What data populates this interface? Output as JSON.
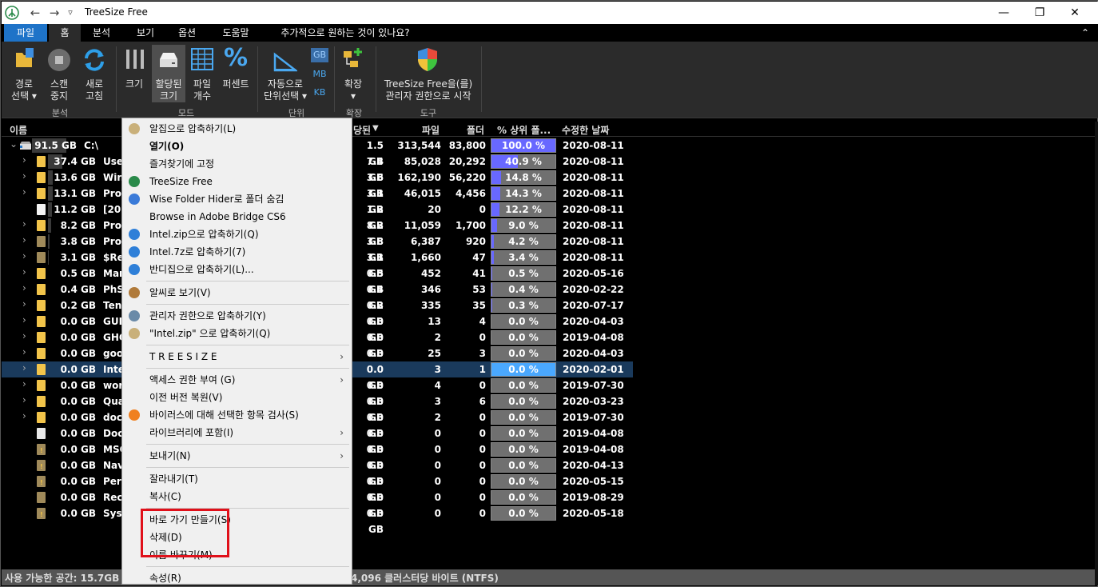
{
  "window": {
    "title": "TreeSize Free",
    "btn_min": "—",
    "btn_max": "❐",
    "btn_close": "✕"
  },
  "quickaccess": {
    "back": "←",
    "forward": "→",
    "dropdown": "▿"
  },
  "menu": {
    "file": "파일",
    "home": "홈",
    "analysis": "분석",
    "view": "보기",
    "options": "옵션",
    "help": "도움말",
    "search": "추가적으로 원하는 것이 있나요?",
    "collapse": "⌃"
  },
  "ribbon": {
    "path_select_1": "경로",
    "path_select_2": "선택 ▾",
    "scan_stop_1": "스캔",
    "scan_stop_2": "중지",
    "refresh_1": "새로",
    "refresh_2": "고침",
    "grp_analysis": "분석",
    "size": "크기",
    "alloc_size_1": "할당된",
    "alloc_size_2": "크기",
    "file_count_1": "파일",
    "file_count_2": "개수",
    "percent": "퍼센트",
    "grp_mode": "모드",
    "auto_unit_1": "자동으로",
    "auto_unit_2": "단위선택 ▾",
    "unit_gb": "GB",
    "unit_mb": "MB",
    "unit_kb": "KB",
    "grp_unit": "단위",
    "expand_1": "확장",
    "expand_2": "▾",
    "grp_expand": "확장",
    "admin_1": "TreeSize Free을(를)",
    "admin_2": "관리자 권한으로 시작",
    "grp_tools": "도구"
  },
  "columns": {
    "name": "이름",
    "alloc": "당된",
    "files": "파일",
    "folders": "폴더",
    "pct": "% 상위 폴...",
    "modified": "수정한 날짜"
  },
  "root": {
    "expand": "⌄",
    "size": "91.5 GB",
    "name": "C:\\",
    "alloc": "1.5 GB",
    "files": "313,544",
    "folders": "83,800",
    "pct": "100.0 %",
    "pct_value": 100,
    "date": "2020-08-11"
  },
  "rows": [
    {
      "expand": "›",
      "size": "37.4 GB",
      "name": "User",
      "alloc": "7.4 GB",
      "files": "85,028",
      "folders": "20,292",
      "pct": "40.9 %",
      "pct_value": 40.9,
      "date": "2020-08-11",
      "icon": "folder"
    },
    {
      "expand": "›",
      "size": "13.6 GB",
      "name": "Win",
      "alloc": "3.6 GB",
      "files": "162,190",
      "folders": "56,220",
      "pct": "14.8 %",
      "pct_value": 14.8,
      "date": "2020-08-11",
      "icon": "folder"
    },
    {
      "expand": "›",
      "size": "13.1 GB",
      "name": "Pro",
      "alloc": "3.1 GB",
      "files": "46,015",
      "folders": "4,456",
      "pct": "14.3 %",
      "pct_value": 14.3,
      "date": "2020-08-11",
      "icon": "folder"
    },
    {
      "expand": "",
      "size": "11.2 GB",
      "name": "[20",
      "alloc": "1.2 GB",
      "files": "20",
      "folders": "0",
      "pct": "12.2 %",
      "pct_value": 12.2,
      "date": "2020-08-11",
      "icon": "file"
    },
    {
      "expand": "›",
      "size": "8.2 GB",
      "name": "Pro",
      "alloc": "8.2 GB",
      "files": "11,059",
      "folders": "1,700",
      "pct": "9.0 %",
      "pct_value": 9.0,
      "date": "2020-08-11",
      "icon": "folder"
    },
    {
      "expand": "›",
      "size": "3.8 GB",
      "name": "Pro",
      "alloc": "3.8 GB",
      "files": "6,387",
      "folders": "920",
      "pct": "4.2 %",
      "pct_value": 4.2,
      "date": "2020-08-11",
      "icon": "folder-dim"
    },
    {
      "expand": "›",
      "size": "3.1 GB",
      "name": "$Re",
      "alloc": "3.1 GB",
      "files": "1,660",
      "folders": "47",
      "pct": "3.4 %",
      "pct_value": 3.4,
      "date": "2020-08-11",
      "icon": "folder-dim"
    },
    {
      "expand": "›",
      "size": "0.5 GB",
      "name": "Mar",
      "alloc": "0.5 GB",
      "files": "452",
      "folders": "41",
      "pct": "0.5 %",
      "pct_value": 0.5,
      "date": "2020-05-16",
      "icon": "folder"
    },
    {
      "expand": "›",
      "size": "0.4 GB",
      "name": "PhS",
      "alloc": "0.4 GB",
      "files": "346",
      "folders": "53",
      "pct": "0.4 %",
      "pct_value": 0.4,
      "date": "2020-02-22",
      "icon": "folder"
    },
    {
      "expand": "›",
      "size": "0.2 GB",
      "name": "Ten",
      "alloc": "0.2 GB",
      "files": "335",
      "folders": "35",
      "pct": "0.3 %",
      "pct_value": 0.3,
      "date": "2020-07-17",
      "icon": "folder"
    },
    {
      "expand": "›",
      "size": "0.0 GB",
      "name": "GUI",
      "alloc": "0.0 GB",
      "files": "13",
      "folders": "4",
      "pct": "0.0 %",
      "pct_value": 0,
      "date": "2020-04-03",
      "icon": "folder"
    },
    {
      "expand": "›",
      "size": "0.0 GB",
      "name": "GHC",
      "alloc": "0.0 GB",
      "files": "2",
      "folders": "0",
      "pct": "0.0 %",
      "pct_value": 0,
      "date": "2019-04-08",
      "icon": "folder"
    },
    {
      "expand": "›",
      "size": "0.0 GB",
      "name": "goo",
      "alloc": "0.0 GB",
      "files": "25",
      "folders": "3",
      "pct": "0.0 %",
      "pct_value": 0,
      "date": "2020-04-03",
      "icon": "folder"
    },
    {
      "expand": "›",
      "size": "0.0 GB",
      "name": "Inte",
      "alloc": "0.0 GB",
      "files": "3",
      "folders": "1",
      "pct": "0.0 %",
      "pct_value": 0,
      "date": "2020-02-01",
      "icon": "folder",
      "selected": true
    },
    {
      "expand": "›",
      "size": "0.0 GB",
      "name": "wor",
      "alloc": "0.0 GB",
      "files": "4",
      "folders": "0",
      "pct": "0.0 %",
      "pct_value": 0,
      "date": "2019-07-30",
      "icon": "folder"
    },
    {
      "expand": "›",
      "size": "0.0 GB",
      "name": "Qua",
      "alloc": "0.0 GB",
      "files": "3",
      "folders": "6",
      "pct": "0.0 %",
      "pct_value": 0,
      "date": "2020-03-23",
      "icon": "folder"
    },
    {
      "expand": "›",
      "size": "0.0 GB",
      "name": "doc",
      "alloc": "0.0 GB",
      "files": "2",
      "folders": "0",
      "pct": "0.0 %",
      "pct_value": 0,
      "date": "2019-07-30",
      "icon": "folder"
    },
    {
      "expand": "",
      "size": "0.0 GB",
      "name": "Doc",
      "alloc": "0.0 GB",
      "files": "0",
      "folders": "0",
      "pct": "0.0 %",
      "pct_value": 0,
      "date": "2019-04-08",
      "icon": "shortcut"
    },
    {
      "expand": "",
      "size": "0.0 GB",
      "name": "MSC",
      "alloc": "0.0 GB",
      "files": "0",
      "folders": "0",
      "pct": "0.0 %",
      "pct_value": 0,
      "date": "2019-04-08",
      "icon": "locked"
    },
    {
      "expand": "",
      "size": "0.0 GB",
      "name": "Nav",
      "alloc": "0.0 GB",
      "files": "0",
      "folders": "0",
      "pct": "0.0 %",
      "pct_value": 0,
      "date": "2020-04-13",
      "icon": "locked"
    },
    {
      "expand": "",
      "size": "0.0 GB",
      "name": "Per",
      "alloc": "0.0 GB",
      "files": "0",
      "folders": "0",
      "pct": "0.0 %",
      "pct_value": 0,
      "date": "2020-05-15",
      "icon": "locked"
    },
    {
      "expand": "",
      "size": "0.0 GB",
      "name": "Rec",
      "alloc": "0.0 GB",
      "files": "0",
      "folders": "0",
      "pct": "0.0 %",
      "pct_value": 0,
      "date": "2019-08-29",
      "icon": "folder-dim"
    },
    {
      "expand": "",
      "size": "0.0 GB",
      "name": "Sys",
      "alloc": "0.0 GB",
      "files": "0",
      "folders": "0",
      "pct": "0.0 %",
      "pct_value": 0,
      "date": "2020-05-18",
      "icon": "locked"
    }
  ],
  "status": {
    "free": "사용 가능한 공간: 15.7GB",
    "cluster": "4,096 클러스터당 바이트 (NTFS)"
  },
  "context_menu": [
    {
      "label": "알집으로 압축하기(L)",
      "icon": "alzip-icon"
    },
    {
      "label": "열기(O)",
      "bold": true
    },
    {
      "label": "즐겨찾기에 고정"
    },
    {
      "label": "TreeSize Free",
      "icon": "treesize-icon"
    },
    {
      "label": "Wise Folder Hider로 폴더 숨김",
      "icon": "wise-icon"
    },
    {
      "label": "Browse in Adobe Bridge CS6"
    },
    {
      "label": "Intel.zip으로 압축하기(Q)",
      "icon": "bandizip-icon"
    },
    {
      "label": "Intel.7z로 압축하기(7)",
      "icon": "bandizip-icon"
    },
    {
      "label": "반디집으로 압축하기(L)...",
      "icon": "bandizip-icon"
    },
    {
      "sep": true
    },
    {
      "label": "알씨로 보기(V)",
      "icon": "alsee-icon"
    },
    {
      "sep": true
    },
    {
      "label": "관리자 권한으로 압축하기(Y)",
      "icon": "alzip-admin-icon"
    },
    {
      "label": "\"Intel.zip\" 으로 압축하기(Q)",
      "icon": "alzip-icon"
    },
    {
      "sep": true
    },
    {
      "label": "T R E E S I Z E",
      "arrow": "›"
    },
    {
      "sep": true
    },
    {
      "label": "액세스 권한 부여 (G)",
      "arrow": "›"
    },
    {
      "label": "이전 버전 복원(V)"
    },
    {
      "label": "바이러스에 대해 선택한 항목 검사(S)",
      "icon": "avast-icon"
    },
    {
      "label": "라이브러리에 포함(I)",
      "arrow": "›"
    },
    {
      "sep": true
    },
    {
      "label": "보내기(N)",
      "arrow": "›"
    },
    {
      "sep": true
    },
    {
      "label": "잘라내기(T)"
    },
    {
      "label": "복사(C)"
    },
    {
      "sep": true
    },
    {
      "label": "바로 가기 만들기(S)"
    },
    {
      "label": "삭제(D)"
    },
    {
      "label": "이름 바꾸기(M)"
    },
    {
      "sep": true
    },
    {
      "label": "속성(R)"
    }
  ],
  "colors": {
    "accent": "#1e73c8",
    "pct_fill": "#6868ff",
    "highlight": "#e0101a",
    "folder": "#f2c44a"
  }
}
